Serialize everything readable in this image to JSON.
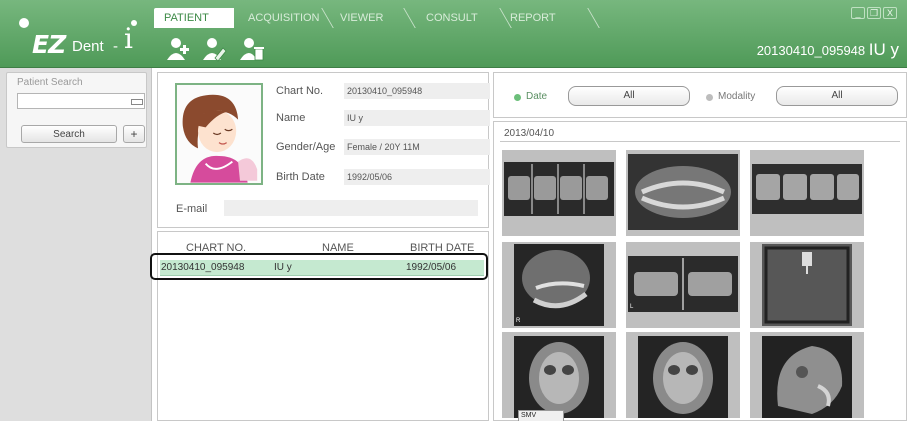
{
  "app": {
    "logo_brand": "EZ",
    "logo_product": "Dent",
    "logo_separator": "-",
    "logo_suffix": "i"
  },
  "tabs": [
    {
      "label": "PATIENT",
      "active": true
    },
    {
      "label": "ACQUISITION",
      "active": false
    },
    {
      "label": "VIEWER",
      "active": false
    },
    {
      "label": "CONSULT",
      "active": false
    },
    {
      "label": "REPORT",
      "active": false
    }
  ],
  "toolbar": {
    "icons": [
      "add-patient-icon",
      "edit-patient-icon",
      "delete-patient-icon"
    ]
  },
  "window_controls": {
    "minimize": "_",
    "restore": "❐",
    "close": "X"
  },
  "header": {
    "patient_id": "20130410_095948",
    "patient_name": "IU y"
  },
  "search": {
    "title": "Patient Search",
    "input_value": "",
    "search_label": "Search",
    "add_label": "+"
  },
  "patient": {
    "chart_no_label": "Chart No.",
    "chart_no": "20130410_095948",
    "name_label": "Name",
    "name": "IU y",
    "gender_age_label": "Gender/Age",
    "gender_age": "Female / 20Y 11M",
    "birth_date_label": "Birth Date",
    "birth_date": "1992/05/06",
    "email_label": "E-mail",
    "email": ""
  },
  "patient_list": {
    "columns": [
      "CHART NO.",
      "NAME",
      "BIRTH DATE"
    ],
    "rows": [
      {
        "chart_no": "20130410_095948",
        "name": "IU y",
        "birth_date": "1992/05/06",
        "selected": true
      }
    ]
  },
  "filters": {
    "date_label": "Date",
    "date_value": "All",
    "date_selected": true,
    "modality_label": "Modality",
    "modality_value": "All",
    "modality_selected": false
  },
  "gallery": {
    "date_group": "2013/04/10",
    "thumbnails": [
      {
        "type": "bitewing-series"
      },
      {
        "type": "panoramic"
      },
      {
        "type": "periapical-series"
      },
      {
        "type": "ceph-lateral-oblique",
        "tag": "R"
      },
      {
        "type": "bitewing-pair",
        "tag": "L"
      },
      {
        "type": "sensor-image"
      },
      {
        "type": "skull-pa"
      },
      {
        "type": "skull-pa"
      },
      {
        "type": "ceph-lateral"
      }
    ],
    "smv_label": "SMV"
  },
  "colors": {
    "header_green": "#5ea866",
    "selected_row": "#c5e9d0",
    "radio_active": "#6cbf7a"
  }
}
